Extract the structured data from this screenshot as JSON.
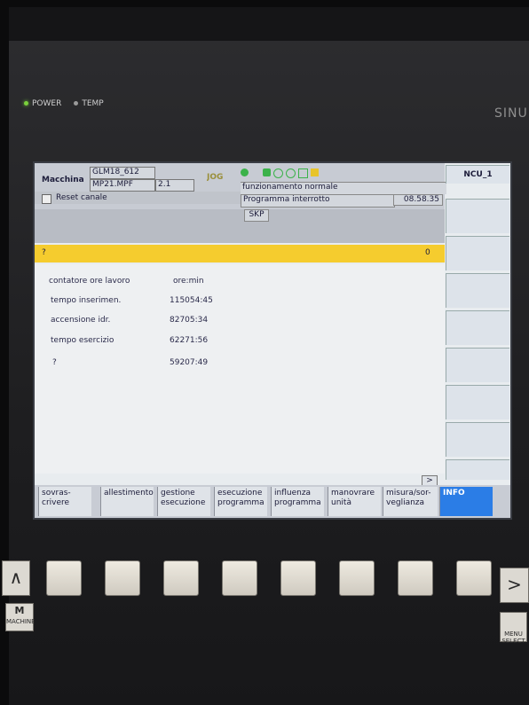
{
  "panel": {
    "power_label": "POWER",
    "temp_label": "TEMP",
    "brand": "SINU"
  },
  "header": {
    "machine_label": "Macchina",
    "program_name": "GLM18_612",
    "program_file": "MP21.MPF",
    "program_version": "2.1",
    "mode": "JOG",
    "status_text": "funzionamento normale",
    "reset_label": "Reset canale",
    "program_status": "Programma interrotto",
    "time": "08.58.35",
    "ncu": "NCU_1",
    "skp": "SKP"
  },
  "alarm": {
    "symbol": "?",
    "count": "0"
  },
  "content": {
    "title_label": "contatore ore lavoro",
    "title_unit": "ore:min",
    "rows": [
      {
        "label": "tempo inserimen.",
        "value": "115054:45"
      },
      {
        "label": "accensione idr.",
        "value": "82705:34"
      },
      {
        "label": "tempo esercizio",
        "value": "62271:56"
      },
      {
        "label": "?",
        "value": "59207:49"
      }
    ]
  },
  "softkeys_bottom": [
    {
      "line1": "sovras-",
      "line2": "crivere"
    },
    {
      "line1": "allestimento",
      "line2": ""
    },
    {
      "line1": "gestione",
      "line2": "esecuzione"
    },
    {
      "line1": "esecuzione",
      "line2": "programma"
    },
    {
      "line1": "influenza",
      "line2": "programma"
    },
    {
      "line1": "manovrare",
      "line2": "unità"
    },
    {
      "line1": "misura/sor-",
      "line2": "veglianza"
    },
    {
      "line1": "INFO",
      "line2": ""
    }
  ],
  "scroll_right": ">",
  "hardware_keys": {
    "machine_key": "M",
    "machine_label": "MACHINE",
    "menu_select": "MENU SELECT"
  },
  "colors": {
    "alarm_yellow": "#f5cc2e",
    "info_blue": "#2b7de6",
    "screen_bg": "#e8ecef"
  }
}
